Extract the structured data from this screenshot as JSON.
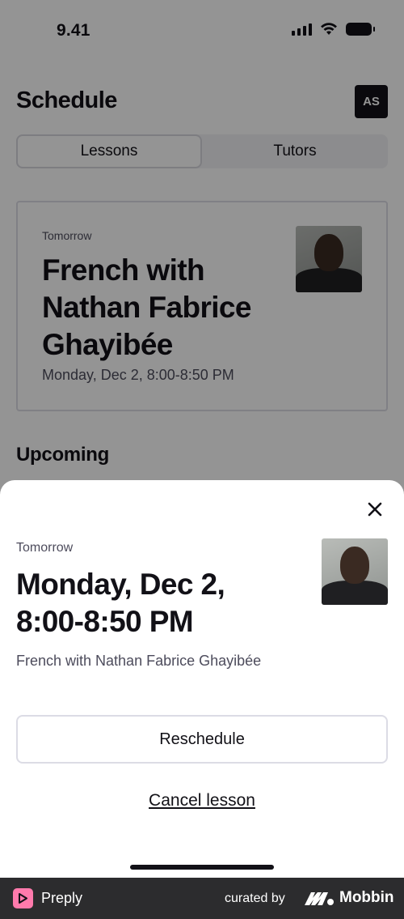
{
  "status_bar": {
    "time": "9.41"
  },
  "header": {
    "title": "Schedule",
    "avatar_initials": "AS"
  },
  "tabs": [
    {
      "label": "Lessons",
      "active": true
    },
    {
      "label": "Tutors",
      "active": false
    }
  ],
  "next_lesson": {
    "when": "Tomorrow",
    "title": "French with Nathan Fabrice Ghayibée",
    "time": "Monday, Dec 2, 8:00-8:50 PM"
  },
  "section_upcoming": "Upcoming",
  "sheet": {
    "when": "Tomorrow",
    "title": "Monday, Dec 2, 8:00-8:50 PM",
    "subtitle": "French with Nathan Fabrice Ghayibée",
    "reschedule_label": "Reschedule",
    "cancel_label": "Cancel lesson"
  },
  "footer": {
    "app_name": "Preply",
    "curated_by": "curated by",
    "brand": "Mobbin"
  },
  "icons": [
    "signal-icon",
    "wifi-icon",
    "battery-icon",
    "close-icon",
    "preply-logo-icon",
    "mobbin-logo-icon"
  ],
  "colors": {
    "accent_pink": "#ff7aac",
    "ink": "#121117",
    "footer_bg": "#2c2c2e"
  }
}
